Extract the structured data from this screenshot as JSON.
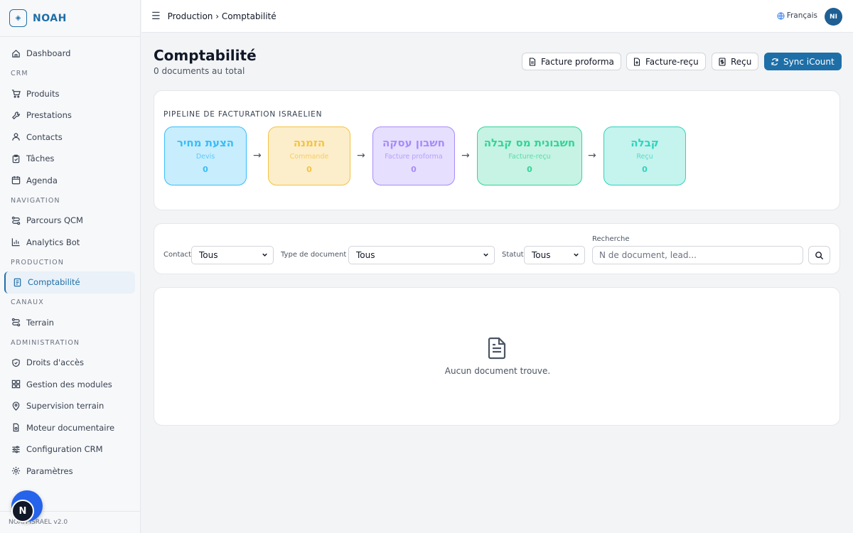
{
  "app": {
    "name": "NOAH",
    "version": "NOAH ISRAEL v2.0",
    "accent": "#1e6fa8"
  },
  "sidebar": {
    "dashboard": "Dashboard",
    "sections": {
      "crm": "CRM",
      "navigation": "NAVIGATION",
      "production": "PRODUCTION",
      "canaux": "CANAUX",
      "administration": "ADMINISTRATION"
    },
    "items": {
      "produits": "Produits",
      "prestations": "Prestations",
      "contacts": "Contacts",
      "taches": "Tâches",
      "agenda": "Agenda",
      "parcours": "Parcours QCM",
      "analytics": "Analytics Bot",
      "comptabilite": "Comptabilité",
      "terrain": "Terrain",
      "droits": "Droits d'accès",
      "modules": "Gestion des modules",
      "supervision": "Supervision terrain",
      "moteur": "Moteur documentaire",
      "config": "Configuration CRM",
      "parametres": "Paramètres"
    },
    "active": "comptabilite"
  },
  "fab": {
    "label": "N"
  },
  "topbar": {
    "breadcrumb": "Production › Comptabilité",
    "language": "Français",
    "avatar": "NI"
  },
  "page": {
    "title": "Comptabilité",
    "subtitle": "0 documents au total"
  },
  "actions": {
    "proforma": "Facture proforma",
    "facture_recu": "Facture-reçu",
    "recu": "Reçu",
    "sync": "Sync iCount"
  },
  "pipeline": {
    "title": "PIPELINE DE FACTURATION ISRAELIEN",
    "stages": [
      {
        "hebrew": "הצעת מחיר",
        "french": "Devis",
        "count": "0",
        "color": "#38bdf8"
      },
      {
        "hebrew": "הזמנה",
        "french": "Commande",
        "count": "0",
        "color": "#f5c242"
      },
      {
        "hebrew": "חשבון עסקה",
        "french": "Facture proforma",
        "count": "0",
        "color": "#a78bfa"
      },
      {
        "hebrew": "חשבונית מס קבלה",
        "french": "Facture-reçu",
        "count": "0",
        "color": "#34d399"
      },
      {
        "hebrew": "קבלה",
        "french": "Reçu",
        "count": "0",
        "color": "#2dd4bf"
      }
    ]
  },
  "filters": {
    "contact_label": "Contact",
    "contact_value": "Tous",
    "type_label": "Type de document",
    "type_value": "Tous",
    "statut_label": "Statut",
    "statut_value": "Tous",
    "search_label": "Recherche",
    "search_placeholder": "N de document, lead..."
  },
  "empty": {
    "message": "Aucun document trouve."
  }
}
